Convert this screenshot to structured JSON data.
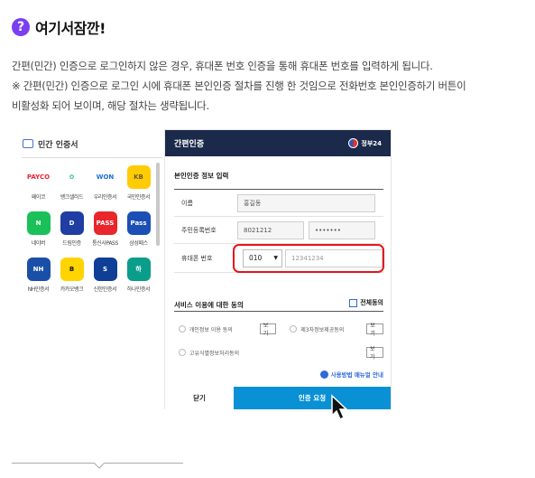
{
  "header": {
    "badge": "?",
    "title": "여기서잠깐!"
  },
  "description": {
    "line1": "간편(민간) 인증으로 로그인하지 않은 경우, 휴대폰 번호 인증을 통해 휴대폰 번호를 입력하게  됩니다.",
    "line2": "※ 간편(민간) 인증으로 로그인 시에 휴대폰 본인인증 절차를 진행 한 것임으로 전화번호 본인인증하기 버튼이",
    "line3": "비활성화 되어 보이며,  해당 절차는 생략됩니다."
  },
  "left_panel": {
    "title": "민간 인증서",
    "certs": [
      {
        "label": "페이코",
        "mark": "PAYCO",
        "color": "#e8262b",
        "bg": "#ffffff"
      },
      {
        "label": "뱅크샐러드",
        "mark": "✿",
        "color": "#3ec28f",
        "bg": "#ffffff"
      },
      {
        "label": "우리인증서",
        "mark": "WON",
        "color": "#1c6fd6",
        "bg": "#ffffff"
      },
      {
        "label": "국민인증서",
        "mark": "KB",
        "color": "#6b5b2a",
        "bg": "#ffcb05"
      },
      {
        "label": "네이버",
        "mark": "N",
        "color": "#ffffff",
        "bg": "#19c158"
      },
      {
        "label": "드림인증",
        "mark": "D",
        "color": "#ffffff",
        "bg": "#1f3da3"
      },
      {
        "label": "통신사PASS",
        "mark": "PASS",
        "color": "#ffffff",
        "bg": "#e8262b"
      },
      {
        "label": "삼성패스",
        "mark": "Pass",
        "color": "#ffffff",
        "bg": "#1b4fb5"
      },
      {
        "label": "NH인증서",
        "mark": "NH",
        "color": "#ffffff",
        "bg": "#1a4fa8"
      },
      {
        "label": "카카오뱅크",
        "mark": "B",
        "color": "#111111",
        "bg": "#ffd400"
      },
      {
        "label": "신한인증서",
        "mark": "S",
        "color": "#ffffff",
        "bg": "#0f3e97"
      },
      {
        "label": "하나인증서",
        "mark": "하",
        "color": "#ffffff",
        "bg": "#0a9d8a"
      }
    ]
  },
  "auth_panel": {
    "title": "간편인증",
    "gov_label": "정부24",
    "section_title": "본인인증 정보 입력",
    "name_label": "이름",
    "name_value": "홍길동",
    "rrn_label": "주민등록번호",
    "rrn_front": "8021212",
    "rrn_back": "•••••••",
    "phone_label": "휴대폰 번호",
    "phone_prefix": "010",
    "phone_placeholder": "12341234",
    "agree_title": "서비스 이용에 대한 동의",
    "agree_all": "전체동의",
    "consent1": "개인정보 이용 동의",
    "consent2": "제3자정보제공동의",
    "consent3": "고유식별정보처리동의",
    "view_label": "보기",
    "guide_label": "사용방법 매뉴얼 안내",
    "close_button": "닫기",
    "request_button": "인증 요청"
  }
}
